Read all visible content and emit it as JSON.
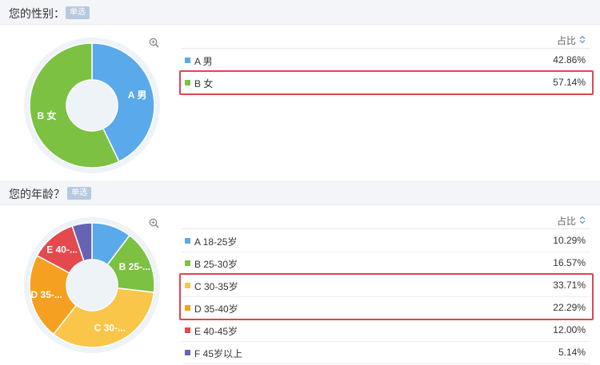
{
  "badge_label": "单选",
  "column_header": "占比",
  "colors": {
    "blue": "#5aa9ea",
    "green": "#7cc142",
    "yellow": "#f9c64a",
    "orange": "#f5a020",
    "red": "#e4494d",
    "purple": "#6663b2",
    "highlight": "#e0454e"
  },
  "icons": [
    "zoom-in-icon",
    "sort-icon"
  ],
  "questions": [
    {
      "title": "您的性别：",
      "highlighted": [
        "B 女"
      ]
    },
    {
      "title": "您的年龄？",
      "highlighted": [
        "C 30-35岁",
        "D 35-40岁"
      ]
    }
  ],
  "chart_data": [
    {
      "type": "pie",
      "categories": [
        "A 男",
        "B 女"
      ],
      "values": [
        42.86,
        57.14
      ],
      "value_labels": [
        "42.86%",
        "57.14%"
      ],
      "slice_labels": [
        "A 男",
        "B 女"
      ],
      "colors": [
        "#5aa9ea",
        "#7cc142"
      ]
    },
    {
      "type": "pie",
      "categories": [
        "A 18-25岁",
        "B 25-30岁",
        "C 30-35岁",
        "D 35-40岁",
        "E 40-45岁",
        "F 45岁以上"
      ],
      "values": [
        10.29,
        16.57,
        33.71,
        22.29,
        12.0,
        5.14
      ],
      "value_labels": [
        "10.29%",
        "16.57%",
        "33.71%",
        "22.29%",
        "12.00%",
        "5.14%"
      ],
      "slice_labels": [
        "",
        "B 25-...",
        "C 30-...",
        "D 35-...",
        "E 40-...",
        ""
      ],
      "colors": [
        "#5aa9ea",
        "#7cc142",
        "#f9c64a",
        "#f5a020",
        "#e4494d",
        "#6663b2"
      ]
    }
  ]
}
